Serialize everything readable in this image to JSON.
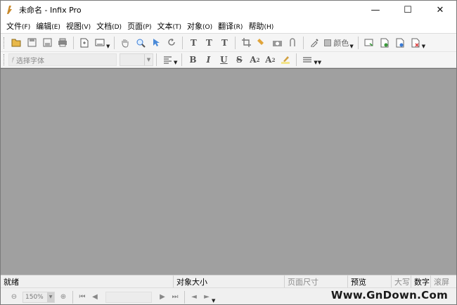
{
  "window": {
    "title": "未命名 - Infix Pro",
    "controls": {
      "minimize": "—",
      "maximize": "☐",
      "close": "✕"
    }
  },
  "menu": [
    {
      "label": "文件",
      "accel": "(F)"
    },
    {
      "label": "编辑",
      "accel": "(E)"
    },
    {
      "label": "视图",
      "accel": "(V)"
    },
    {
      "label": "文档",
      "accel": "(D)"
    },
    {
      "label": "页面",
      "accel": "(P)"
    },
    {
      "label": "文本",
      "accel": "(T)"
    },
    {
      "label": "对象",
      "accel": "(O)"
    },
    {
      "label": "翻译",
      "accel": "(R)"
    },
    {
      "label": "帮助",
      "accel": "(H)"
    }
  ],
  "toolbar2": {
    "font_placeholder": "选择字体",
    "color_label": "颜色",
    "bold": "B",
    "italic": "I",
    "underline": "U",
    "strike": "S",
    "superscript": "A",
    "subscript": "A"
  },
  "status": {
    "ready": "就绪",
    "object_size": "对象大小",
    "page_size": "页面尺寸",
    "preview": "预览",
    "caps": "大写",
    "num": "数字",
    "scroll": "滚屏"
  },
  "nav": {
    "zoom": "150%"
  },
  "watermark": "Www.GnDown.Com",
  "colors": {
    "workspace": "#a0a0a0",
    "toolbar": "#f5f5f5",
    "accent_icon": "#3a7bd5"
  }
}
